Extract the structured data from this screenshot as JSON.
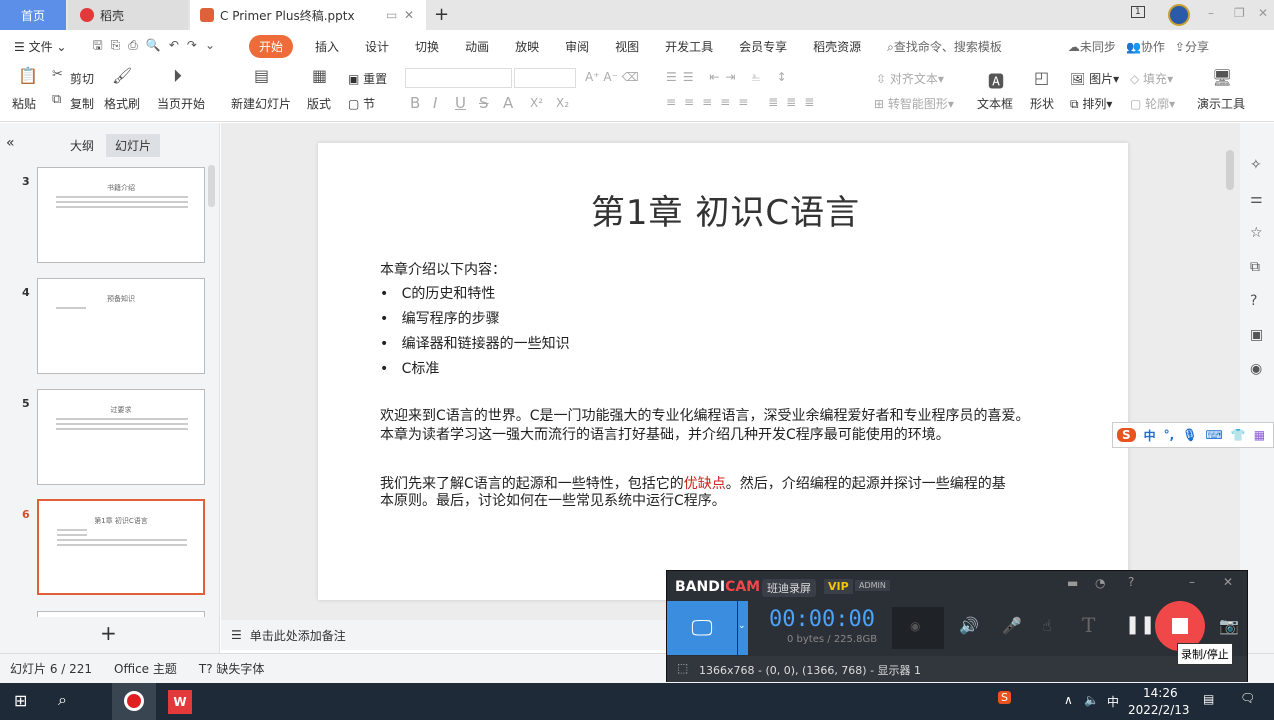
{
  "tabs": {
    "home": "首页",
    "daoke": "稻壳",
    "doc": "C Primer  Plus终稿.pptx",
    "new_tab": "+"
  },
  "window": {
    "badge": "1",
    "minimize": "–",
    "restore": "❐",
    "close": "✕"
  },
  "menu": {
    "file": "文件",
    "items": [
      "开始",
      "插入",
      "设计",
      "切换",
      "动画",
      "放映",
      "审阅",
      "视图",
      "开发工具",
      "会员专享",
      "稻壳资源"
    ],
    "search": "查找命令、搜索模板",
    "sync": "未同步",
    "collab": "协作",
    "share": "分享"
  },
  "ribbon": {
    "paste": "粘贴",
    "cut": "剪切",
    "copy": "复制",
    "format_painter": "格式刷",
    "play_current": "当页开始",
    "new_slide": "新建幻灯片",
    "layout": "版式",
    "reset": "重置",
    "section": "节",
    "bold": "B",
    "italic": "I",
    "underline": "U",
    "strike": "S",
    "font_color": "A",
    "superscript": "X²",
    "subscript": "X₂",
    "align_text": "对齐文本",
    "smart_art": "转智能图形",
    "textbox": "文本框",
    "shape": "形状",
    "picture": "图片",
    "fill": "填充",
    "arrange": "排列",
    "outline": "轮廓",
    "present_tools": "演示工具"
  },
  "panel": {
    "collapse": "«",
    "outline_tab": "大纲",
    "slides_tab": "幻灯片",
    "add": "+",
    "thumbs": [
      {
        "num": "3",
        "title": "书籍介绍"
      },
      {
        "num": "4",
        "title": "预备知识"
      },
      {
        "num": "5",
        "title": "过要求"
      },
      {
        "num": "6",
        "title": "第1章 初识C语言"
      }
    ]
  },
  "slide": {
    "title": "第1章 初识C语言",
    "intro": "本章介绍以下内容：",
    "bullets": [
      "C的历史和特性",
      "编写程序的步骤",
      "编译器和链接器的一些知识",
      "C标准"
    ],
    "para1_l1": "欢迎来到C语言的世界。C是一门功能强大的专业化编程语言，深受业余编程爱好者和专业程序员的喜爱。",
    "para1_l2": "本章为读者学习这一强大而流行的语言打好基础，并介绍几种开发C程序最可能使用的环境。",
    "para2_l1a": "我们先来了解C语言的起源和一些特性，包括它的",
    "para2_red": "优缺点",
    "para2_l1b": "。然后，介绍编程的起源并探讨一些编程的基",
    "para2_l2": "本原则。最后，讨论如何在一些常见系统中运行C程序。"
  },
  "notes": {
    "placeholder": "单击此处添加备注"
  },
  "status": {
    "slide_count": "幻灯片 6 / 221",
    "theme": "Office 主题",
    "missing_font": "缺失字体"
  },
  "ime": {
    "mode": "中",
    "punct": "°,"
  },
  "bandicam": {
    "brand_a": "BANDI",
    "brand_b": "CAM",
    "cn_name": "班迪录屏",
    "vip": "VIP",
    "admin": "ADMIN",
    "timer": "00:00:00",
    "size": "0 bytes / 225.8GB",
    "region": "1366x768 - (0, 0), (1366, 768) - 显示器 1",
    "tooltip": "录制/停止",
    "help": "?",
    "minimize": "–",
    "close": "✕"
  },
  "taskbar": {
    "time": "14:26",
    "date": "2022/2/13",
    "ime": "中"
  },
  "colors": {
    "accent": "#ee6b3a",
    "home_tab": "#5b8fe8",
    "record": "#f04848",
    "timer": "#4aa3ff"
  }
}
